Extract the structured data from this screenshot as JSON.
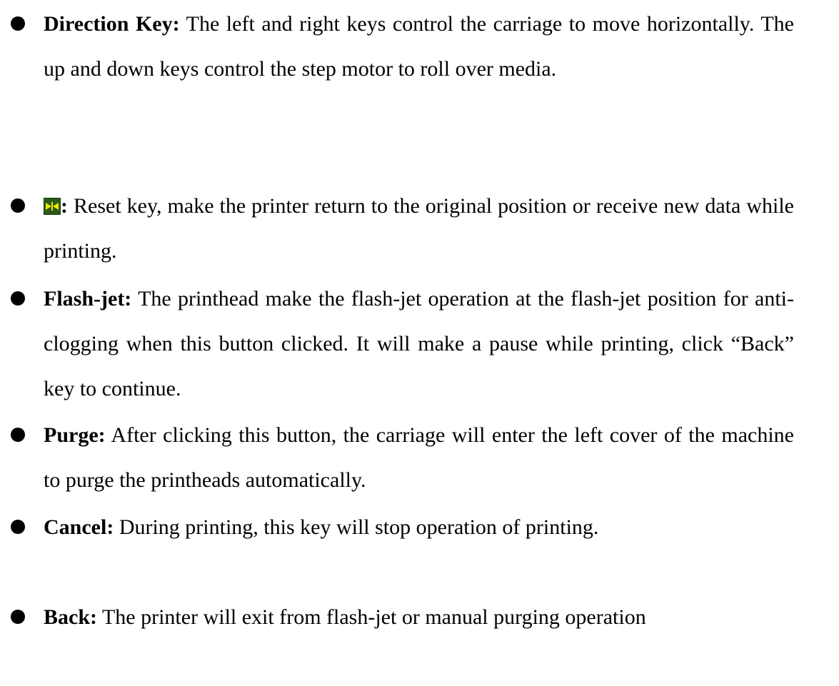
{
  "items": [
    {
      "term": "Direction Key:",
      "text": " The left and right keys control the carriage to move horizontally. The up and down keys control the step motor to roll over media."
    },
    {
      "icon": "reset-icon",
      "term": ":",
      "text": " Reset key, make the printer return to the original position or receive new data while printing."
    },
    {
      "term": "Flash-jet:",
      "text": " The printhead make the flash-jet operation at the flash-jet position for anti-clogging when this button clicked. It will make a pause while printing, click “Back” key to continue."
    },
    {
      "term": "Purge:",
      "text": " After clicking this button, the carriage will enter the left cover of the machine to purge the printheads automatically."
    },
    {
      "term": "Cancel:",
      "text": " During printing, this key will stop operation of printing."
    },
    {
      "term": "Back:",
      "text": " The printer will exit from flash-jet or manual purging operation"
    }
  ],
  "colors": {
    "text": "#000000",
    "icon_bg": "#2a5a1a",
    "icon_fg": "#f2e600"
  }
}
